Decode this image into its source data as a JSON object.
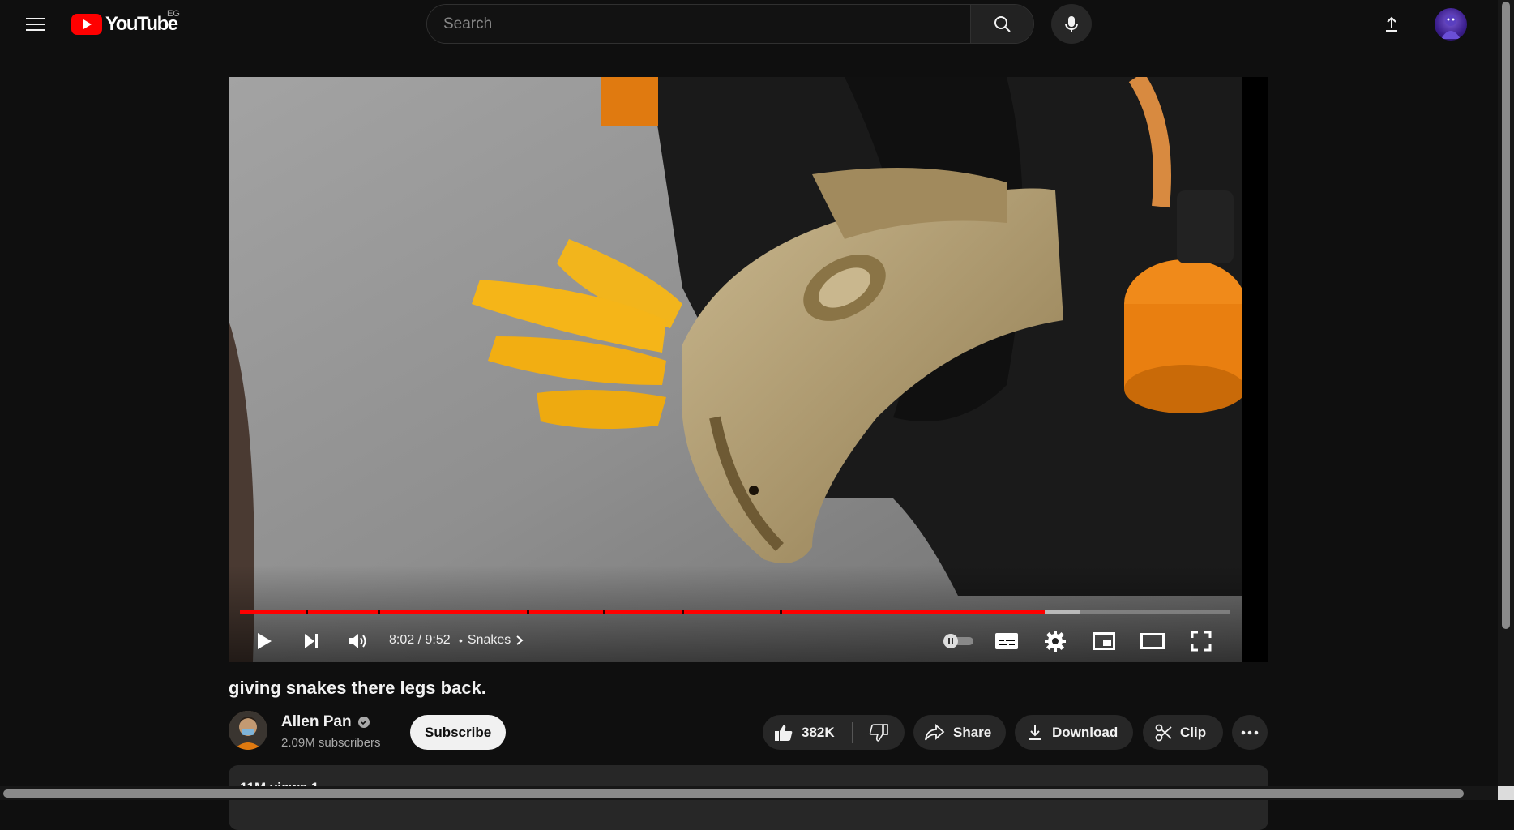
{
  "header": {
    "logo_text": "YouTube",
    "country_code": "EG",
    "search_placeholder": "Search"
  },
  "player": {
    "time": "8:02 / 9:52",
    "chapter_separator": "•",
    "chapter": "Snakes",
    "progress_fraction": 0.813,
    "buffered_fraction": 0.849,
    "chapter_markers": [
      0.066,
      0.139,
      0.29,
      0.367,
      0.446,
      0.545
    ]
  },
  "video": {
    "title": "giving snakes there legs back.",
    "channel_name": "Allen Pan",
    "subscribers": "2.09M subscribers",
    "subscribe_label": "Subscribe",
    "likes": "382K",
    "share_label": "Share",
    "download_label": "Download",
    "clip_label": "Clip",
    "description_preview": "11M views 1"
  },
  "colors": {
    "brand_red": "#ff0000",
    "background": "#0f0f0f",
    "pill_background": "#272727"
  }
}
